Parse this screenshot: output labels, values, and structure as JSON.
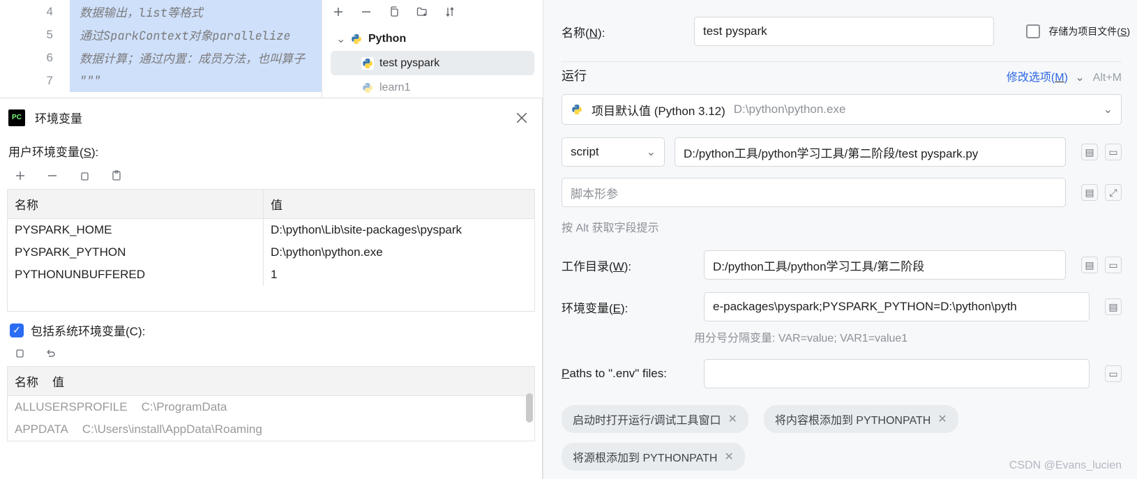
{
  "editor": {
    "lines": [
      {
        "num": "4",
        "text": "数据输出，list等格式"
      },
      {
        "num": "5",
        "text": "通过SparkContext对象parallelize"
      },
      {
        "num": "6",
        "text": "数据计算；通过内置：成员方法，也叫算子"
      },
      {
        "num": "7",
        "text": "\"\"\""
      }
    ]
  },
  "tree": {
    "rootLabel": "Python",
    "items": [
      {
        "label": "test pyspark",
        "selected": true
      },
      {
        "label": "learn1",
        "selected": false
      }
    ]
  },
  "envDialog": {
    "title": "环境变量",
    "userLabel": "用户环境变量(S):",
    "cols": {
      "name": "名称",
      "value": "值"
    },
    "userVars": [
      {
        "name": "PYSPARK_HOME",
        "value": "D:\\python\\Lib\\site-packages\\pyspark"
      },
      {
        "name": "PYSPARK_PYTHON",
        "value": "D:\\python\\python.exe"
      },
      {
        "name": "PYTHONUNBUFFERED",
        "value": "1"
      }
    ],
    "includeSys": "包括系统环境变量(C):",
    "sysVars": [
      {
        "name": "ALLUSERSPROFILE",
        "value": "C:\\ProgramData"
      },
      {
        "name": "APPDATA",
        "value": "C:\\Users\\install\\AppData\\Roaming"
      }
    ]
  },
  "right": {
    "nameLabel": "名称(N):",
    "nameValue": "test pyspark",
    "saveAsFile": "存储为项目文件(S)",
    "runHeader": "运行",
    "modifyOptions": "修改选项(M)",
    "modifyHint": "Alt+M",
    "interpName": "项目默认值 (Python 3.12)",
    "interpPath": "D:\\python\\python.exe",
    "scriptSelect": "script",
    "scriptPath": "D:/python工具/python学习工具/第二阶段/test pyspark.py",
    "scriptParamPh": "脚本形参",
    "altHint": "按 Alt 获取字段提示",
    "workDirLabel": "工作目录(W):",
    "workDirValue": "D:/python工具/python学习工具/第二阶段",
    "envVarLabel": "环境变量(E):",
    "envVarValue": "e-packages\\pyspark;PYSPARK_PYTHON=D:\\python\\pyth",
    "envVarHint": "用分号分隔变量: VAR=value; VAR1=value1",
    "pathsLabel": "Paths to \".env\" files:",
    "pills": [
      "启动时打开运行/调试工具窗口",
      "将内容根添加到 PYTHONPATH",
      "将源根添加到 PYTHONPATH"
    ],
    "watermark": "CSDN @Evans_lucien"
  }
}
